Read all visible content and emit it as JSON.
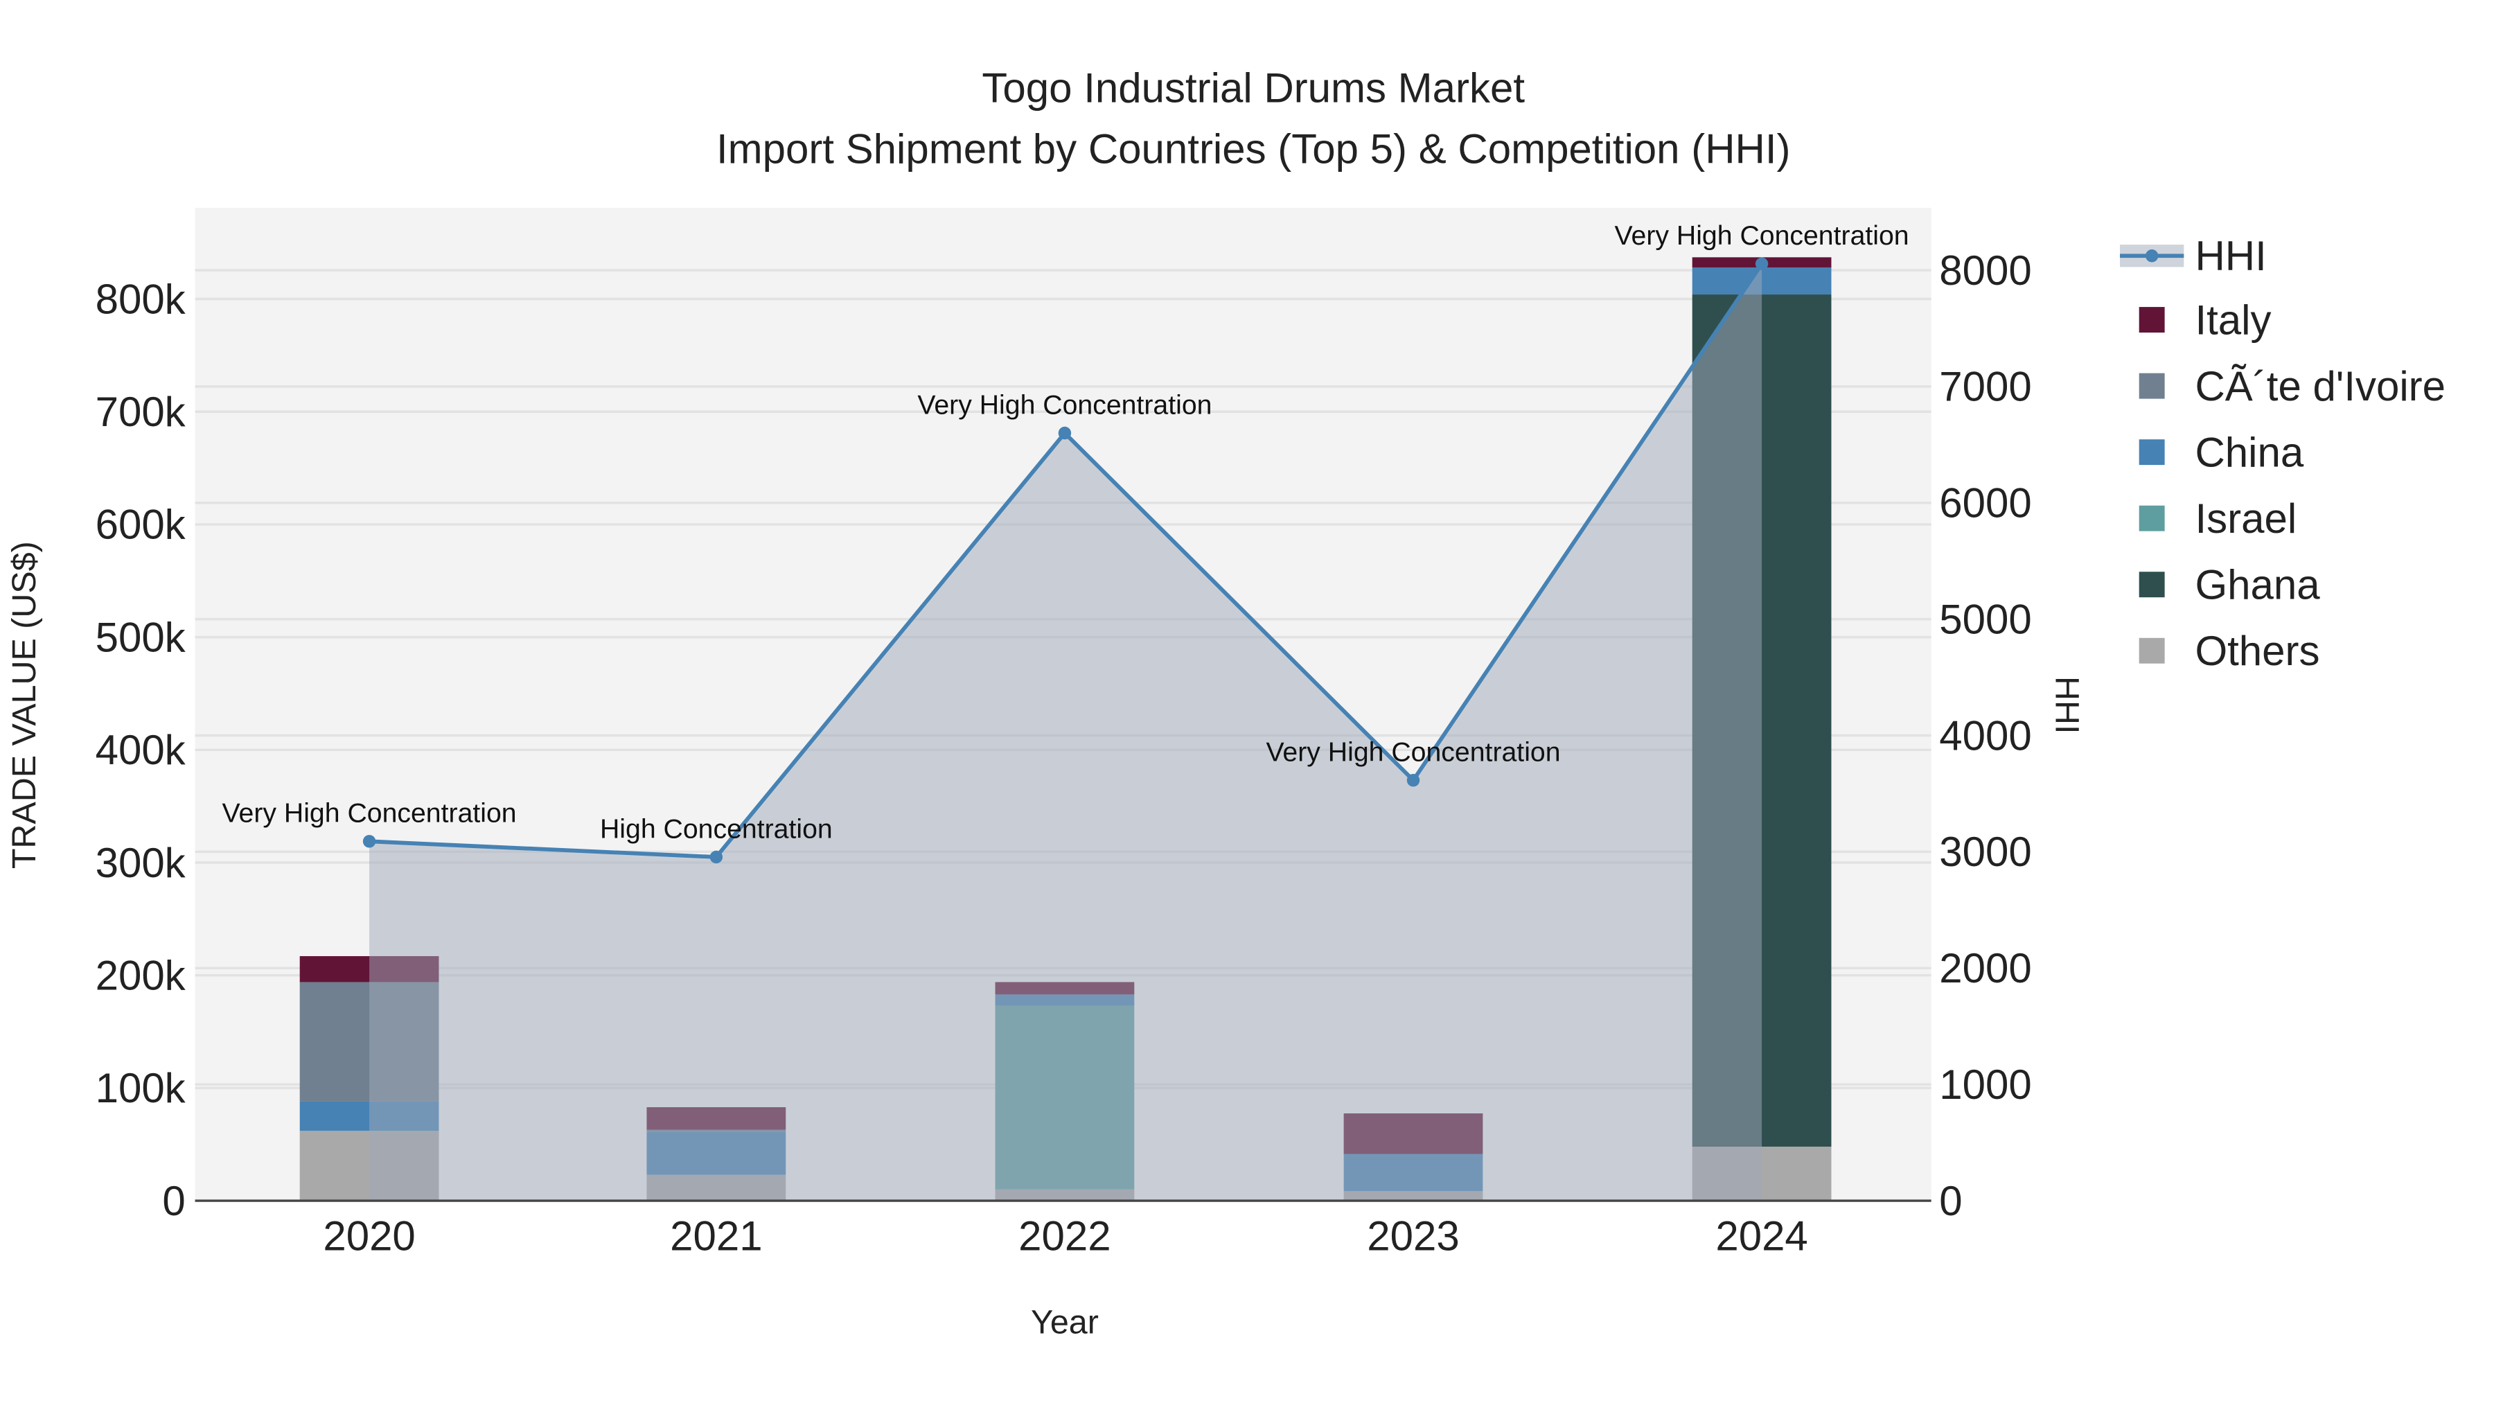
{
  "chart_data": {
    "type": "bar",
    "title": "Togo Industrial Drums Market",
    "subtitle": "Import Shipment by Countries (Top 5) & Competition (HHI)",
    "xlabel": "Year",
    "ylabel": "TRADE VALUE (US$)",
    "y2label": "HHI",
    "categories": [
      "2020",
      "2021",
      "2022",
      "2023",
      "2024"
    ],
    "ylim": [
      0,
      880000
    ],
    "y2lim": [
      0,
      8540
    ],
    "yticks": [
      0,
      100000,
      200000,
      300000,
      400000,
      500000,
      600000,
      700000,
      800000
    ],
    "ytick_labels": [
      "0",
      "100k",
      "200k",
      "300k",
      "400k",
      "500k",
      "600k",
      "700k",
      "800k"
    ],
    "y2ticks": [
      0,
      1000,
      2000,
      3000,
      4000,
      5000,
      6000,
      7000,
      8000
    ],
    "y2tick_labels": [
      "0",
      "1000",
      "2000",
      "3000",
      "4000",
      "5000",
      "6000",
      "7000",
      "8000"
    ],
    "stack_order": [
      "Others",
      "Ghana",
      "Israel",
      "China",
      "Côte d'Ivoire",
      "Italy"
    ],
    "series": [
      {
        "name": "Italy",
        "color": "#621437",
        "values": [
          23000,
          20000,
          11000,
          36000,
          9000
        ]
      },
      {
        "name": "CÃ´te d'Ivoire",
        "key": "Côte d'Ivoire",
        "color": "#708090",
        "values": [
          106000,
          2000,
          0,
          0,
          0
        ]
      },
      {
        "name": "China",
        "color": "#4682b4",
        "values": [
          26000,
          38000,
          10000,
          33000,
          24000
        ]
      },
      {
        "name": "Israel",
        "color": "#5f9ea0",
        "values": [
          0,
          0,
          163000,
          0,
          0
        ]
      },
      {
        "name": "Ghana",
        "color": "#2f4f4f",
        "values": [
          0,
          0,
          0,
          0,
          756000
        ]
      },
      {
        "name": "Others",
        "color": "#a9a9a9",
        "values": [
          62000,
          23000,
          10000,
          8500,
          48000
        ]
      }
    ],
    "line": {
      "name": "HHI",
      "color": "#4682b4",
      "values": [
        3090,
        2955,
        6600,
        3615,
        8055
      ],
      "annotations": [
        "Very High Concentration",
        "High Concentration",
        "Very High Concentration",
        "Very High Concentration",
        "Very High Concentration"
      ]
    },
    "legend": "right"
  }
}
